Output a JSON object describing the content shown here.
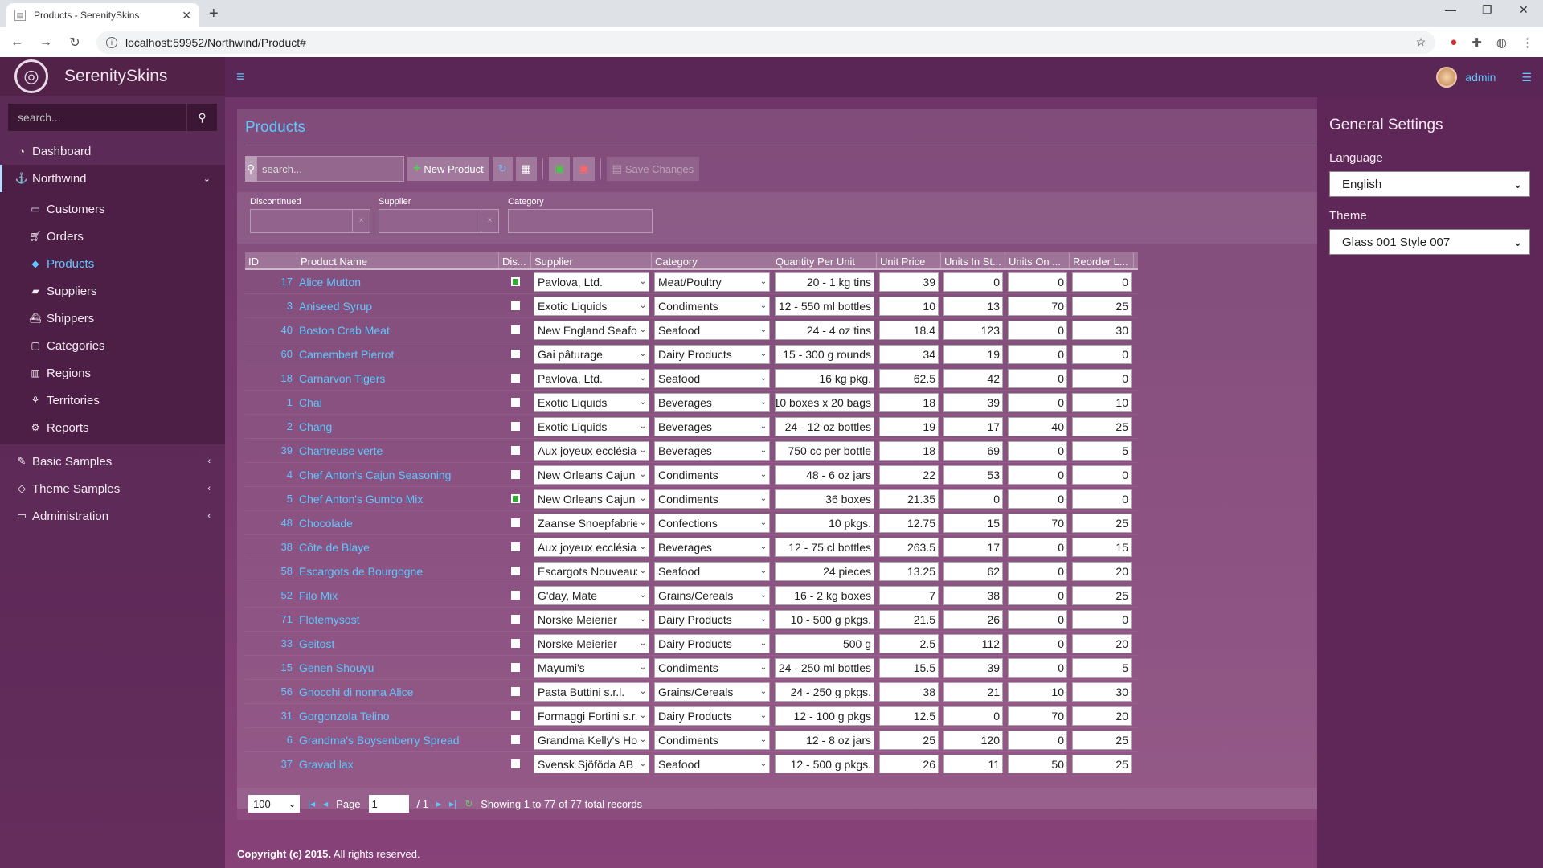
{
  "browser": {
    "tab_title": "Products - SerenitySkins",
    "url": "localhost:59952/Northwind/Product#"
  },
  "app": {
    "brand": "SerenitySkins",
    "search_placeholder": "search..."
  },
  "nav": {
    "dashboard": "Dashboard",
    "northwind": "Northwind",
    "sub": [
      "Customers",
      "Orders",
      "Products",
      "Suppliers",
      "Shippers",
      "Categories",
      "Regions",
      "Territories",
      "Reports"
    ],
    "basic_samples": "Basic Samples",
    "theme_samples": "Theme Samples",
    "administration": "Administration"
  },
  "user": {
    "name": "admin"
  },
  "page": {
    "title": "Products",
    "search_placeholder": "search...",
    "new_product": "New Product",
    "save_changes": "Save Changes"
  },
  "filters": {
    "discontinued": "Discontinued",
    "supplier": "Supplier",
    "category": "Category"
  },
  "columns": [
    "ID",
    "Product Name",
    "Dis...",
    "Supplier",
    "Category",
    "Quantity Per Unit",
    "Unit Price",
    "Units In St...",
    "Units On ...",
    "Reorder L..."
  ],
  "rows": [
    {
      "id": "17",
      "name": "Alice Mutton",
      "dis": true,
      "supplier": "Pavlova, Ltd.",
      "category": "Meat/Poultry",
      "qty": "20 - 1 kg tins",
      "price": "39",
      "stock": "0",
      "order": "0",
      "reorder": "0"
    },
    {
      "id": "3",
      "name": "Aniseed Syrup",
      "dis": false,
      "supplier": "Exotic Liquids",
      "category": "Condiments",
      "qty": "12 - 550 ml bottles",
      "price": "10",
      "stock": "13",
      "order": "70",
      "reorder": "25"
    },
    {
      "id": "40",
      "name": "Boston Crab Meat",
      "dis": false,
      "supplier": "New England Seafood",
      "category": "Seafood",
      "qty": "24 - 4 oz tins",
      "price": "18.4",
      "stock": "123",
      "order": "0",
      "reorder": "30"
    },
    {
      "id": "60",
      "name": "Camembert Pierrot",
      "dis": false,
      "supplier": "Gai pâturage",
      "category": "Dairy Products",
      "qty": "15 - 300 g rounds",
      "price": "34",
      "stock": "19",
      "order": "0",
      "reorder": "0"
    },
    {
      "id": "18",
      "name": "Carnarvon Tigers",
      "dis": false,
      "supplier": "Pavlova, Ltd.",
      "category": "Seafood",
      "qty": "16 kg pkg.",
      "price": "62.5",
      "stock": "42",
      "order": "0",
      "reorder": "0"
    },
    {
      "id": "1",
      "name": "Chai",
      "dis": false,
      "supplier": "Exotic Liquids",
      "category": "Beverages",
      "qty": "10 boxes x 20 bags",
      "price": "18",
      "stock": "39",
      "order": "0",
      "reorder": "10"
    },
    {
      "id": "2",
      "name": "Chang",
      "dis": false,
      "supplier": "Exotic Liquids",
      "category": "Beverages",
      "qty": "24 - 12 oz bottles",
      "price": "19",
      "stock": "17",
      "order": "40",
      "reorder": "25"
    },
    {
      "id": "39",
      "name": "Chartreuse verte",
      "dis": false,
      "supplier": "Aux joyeux ecclésiastiques",
      "category": "Beverages",
      "qty": "750 cc per bottle",
      "price": "18",
      "stock": "69",
      "order": "0",
      "reorder": "5"
    },
    {
      "id": "4",
      "name": "Chef Anton's Cajun Seasoning",
      "dis": false,
      "supplier": "New Orleans Cajun Delights",
      "category": "Condiments",
      "qty": "48 - 6 oz jars",
      "price": "22",
      "stock": "53",
      "order": "0",
      "reorder": "0"
    },
    {
      "id": "5",
      "name": "Chef Anton's Gumbo Mix",
      "dis": true,
      "supplier": "New Orleans Cajun Delights",
      "category": "Condiments",
      "qty": "36 boxes",
      "price": "21.35",
      "stock": "0",
      "order": "0",
      "reorder": "0"
    },
    {
      "id": "48",
      "name": "Chocolade",
      "dis": false,
      "supplier": "Zaanse Snoepfabriek",
      "category": "Confections",
      "qty": "10 pkgs.",
      "price": "12.75",
      "stock": "15",
      "order": "70",
      "reorder": "25"
    },
    {
      "id": "38",
      "name": "Côte de Blaye",
      "dis": false,
      "supplier": "Aux joyeux ecclésiastiques",
      "category": "Beverages",
      "qty": "12 - 75 cl bottles",
      "price": "263.5",
      "stock": "17",
      "order": "0",
      "reorder": "15"
    },
    {
      "id": "58",
      "name": "Escargots de Bourgogne",
      "dis": false,
      "supplier": "Escargots Nouveaux",
      "category": "Seafood",
      "qty": "24 pieces",
      "price": "13.25",
      "stock": "62",
      "order": "0",
      "reorder": "20"
    },
    {
      "id": "52",
      "name": "Filo Mix",
      "dis": false,
      "supplier": "G'day, Mate",
      "category": "Grains/Cereals",
      "qty": "16 - 2 kg boxes",
      "price": "7",
      "stock": "38",
      "order": "0",
      "reorder": "25"
    },
    {
      "id": "71",
      "name": "Flotemysost",
      "dis": false,
      "supplier": "Norske Meierier",
      "category": "Dairy Products",
      "qty": "10 - 500 g pkgs.",
      "price": "21.5",
      "stock": "26",
      "order": "0",
      "reorder": "0"
    },
    {
      "id": "33",
      "name": "Geitost",
      "dis": false,
      "supplier": "Norske Meierier",
      "category": "Dairy Products",
      "qty": "500 g",
      "price": "2.5",
      "stock": "112",
      "order": "0",
      "reorder": "20"
    },
    {
      "id": "15",
      "name": "Genen Shouyu",
      "dis": false,
      "supplier": "Mayumi's",
      "category": "Condiments",
      "qty": "24 - 250 ml bottles",
      "price": "15.5",
      "stock": "39",
      "order": "0",
      "reorder": "5"
    },
    {
      "id": "56",
      "name": "Gnocchi di nonna Alice",
      "dis": false,
      "supplier": "Pasta Buttini s.r.l.",
      "category": "Grains/Cereals",
      "qty": "24 - 250 g pkgs.",
      "price": "38",
      "stock": "21",
      "order": "10",
      "reorder": "30"
    },
    {
      "id": "31",
      "name": "Gorgonzola Telino",
      "dis": false,
      "supplier": "Formaggi Fortini s.r.l.",
      "category": "Dairy Products",
      "qty": "12 - 100 g pkgs",
      "price": "12.5",
      "stock": "0",
      "order": "70",
      "reorder": "20"
    },
    {
      "id": "6",
      "name": "Grandma's Boysenberry Spread",
      "dis": false,
      "supplier": "Grandma Kelly's Homestead",
      "category": "Condiments",
      "qty": "12 - 8 oz jars",
      "price": "25",
      "stock": "120",
      "order": "0",
      "reorder": "25"
    },
    {
      "id": "37",
      "name": "Gravad lax",
      "dis": false,
      "supplier": "Svensk Sjöföda AB",
      "category": "Seafood",
      "qty": "12 - 500 g pkgs.",
      "price": "26",
      "stock": "11",
      "order": "50",
      "reorder": "25"
    }
  ],
  "pager": {
    "page_size": "100",
    "page_label": "Page",
    "page_value": "1",
    "page_total": "/ 1",
    "status": "Showing 1 to 77 of 77 total records"
  },
  "footer": {
    "copyright": "Copyright (c) 2015.",
    "rights": " All rights reserved."
  },
  "settings": {
    "title": "General Settings",
    "language_label": "Language",
    "language_value": "English",
    "theme_label": "Theme",
    "theme_value": "Glass 001 Style 007"
  }
}
